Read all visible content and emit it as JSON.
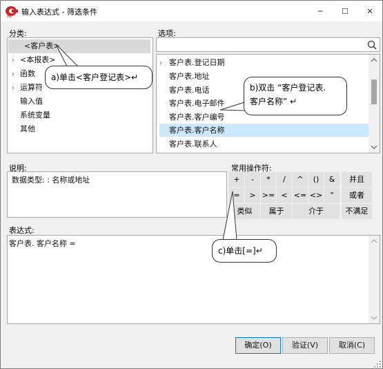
{
  "window": {
    "title": "输入表达式 - 筛选条件",
    "minimize": "─",
    "maximize": "☐",
    "close": "✕"
  },
  "category": {
    "label": "分类:",
    "items": [
      {
        "label": "<客户表>",
        "expand": "",
        "selected": true
      },
      {
        "label": "<本报表>",
        "expand": "›"
      },
      {
        "label": "函数",
        "expand": "›"
      },
      {
        "label": "运算符",
        "expand": "›"
      },
      {
        "label": "输入值",
        "expand": ""
      },
      {
        "label": "系统变量",
        "expand": ""
      },
      {
        "label": "其他",
        "expand": ""
      }
    ]
  },
  "options": {
    "label": "选项:",
    "search_value": "",
    "items": [
      {
        "label": "客户表.登记日期",
        "expand": "›"
      },
      {
        "label": "客户表.地址",
        "expand": ""
      },
      {
        "label": "客户表.电话",
        "expand": ""
      },
      {
        "label": "客户表.电子邮件",
        "expand": ""
      },
      {
        "label": "客户表.客户编号",
        "expand": ""
      },
      {
        "label": "客户表.客户名称",
        "expand": "",
        "selected": true
      },
      {
        "label": "客户表.联系人",
        "expand": ""
      }
    ]
  },
  "description": {
    "label": "说明:",
    "text": "数据类型: : 名称或地址"
  },
  "operators": {
    "label": "常用操作符:",
    "row1": [
      "+",
      "-",
      "*",
      "/",
      "^",
      "()",
      "&"
    ],
    "row2": [
      "=",
      ">",
      ">=",
      "<",
      "<=",
      "<>",
      "\""
    ],
    "row3": [
      "类似",
      "属于",
      "介于"
    ],
    "logic": [
      "并且",
      "或者",
      "不满足"
    ]
  },
  "expression": {
    "label": "表达式:",
    "text": "客户表. 客户名称 ="
  },
  "buttons": {
    "ok": "确定(O)",
    "verify": "验证(V)",
    "cancel": "取消(C)"
  },
  "callouts": {
    "a": "a)单击<客户登记表>↵",
    "b_line1": "b)双击 “客户登记表.",
    "b_line2": "客户名称” ↵",
    "c": "c)单击[=]↵"
  }
}
